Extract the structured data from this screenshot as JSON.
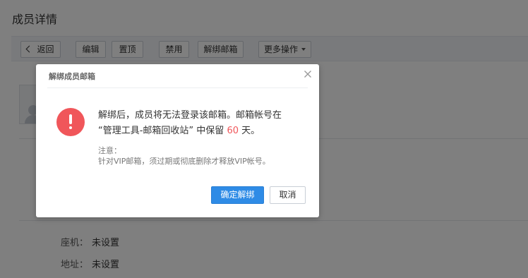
{
  "page": {
    "title": "成员详情"
  },
  "toolbar": {
    "back_label": "返回",
    "edit_label": "编辑",
    "pin_label": "置顶",
    "disable_label": "禁用",
    "unbind_label": "解绑邮箱",
    "more_label": "更多操作"
  },
  "details": {
    "fields": [
      {
        "label": "座机：",
        "value": "未设置"
      },
      {
        "label": "地址：",
        "value": "未设置"
      }
    ]
  },
  "dialog": {
    "title": "解绑成员邮箱",
    "message_part1": "解绑后，成员将无法登录该邮箱。邮箱帐号在",
    "message_part2": "“管理工具-邮箱回收站” 中保留 ",
    "days": "60",
    "message_part3": " 天。",
    "note_title": "注意：",
    "note_body": "针对VIP邮箱，须过期或彻底删除才释放VIP帐号。",
    "confirm_label": "确定解绑",
    "cancel_label": "取消"
  },
  "icons": {
    "alert": "exclamation-circle-icon",
    "close": "close-icon",
    "back": "chevron-left-icon",
    "more": "caret-down-icon",
    "avatar": "user-avatar-icon"
  },
  "colors": {
    "primary": "#2e8be6",
    "danger": "#f0565a"
  }
}
